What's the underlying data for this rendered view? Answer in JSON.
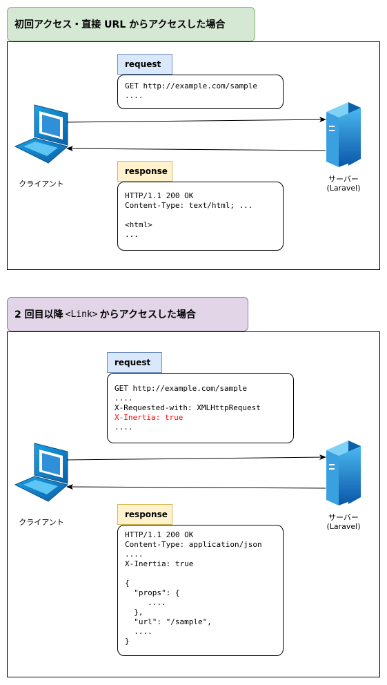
{
  "section1": {
    "title": "初回アクセス・直接 URL からアクセスした場合",
    "request_tag": "request",
    "request_lines": [
      "GET http://example.com/sample",
      "...."
    ],
    "response_tag": "response",
    "response_lines": [
      "HTTP/1.1 200 OK",
      "Content-Type: text/html; ...",
      "",
      "<html>",
      "..."
    ],
    "client_label": "クライアント",
    "server_label": "サーバー",
    "server_sub": "(Laravel)"
  },
  "section2": {
    "title_pre": "2 回目以降",
    "title_code": "<Link>",
    "title_post": "からアクセスした場合",
    "request_tag": "request",
    "request_lines": [
      "GET http://example.com/sample",
      "....",
      "X-Requested-with: XMLHttpRequest",
      "X-Inertia: true",
      "...."
    ],
    "response_tag": "response",
    "response_lines": [
      "HTTP/1.1 200 OK",
      "Content-Type: application/json",
      "....",
      "X-Inertia: true",
      "",
      "{",
      "  \"props\": {",
      "     ....",
      "  },",
      "  \"url\": \"/sample\",",
      "  ....",
      "}"
    ],
    "client_label": "クライアント",
    "server_label": "サーバー",
    "server_sub": "(Laravel)"
  },
  "colors": {
    "highlight": "#ff0000",
    "title1_fill": "#d5e8d4",
    "title2_fill": "#e1d5e7",
    "request_fill": "#dae8fc",
    "response_fill": "#fff2cc"
  },
  "icons": {
    "client": "laptop-icon",
    "server": "server-tower-icon"
  }
}
